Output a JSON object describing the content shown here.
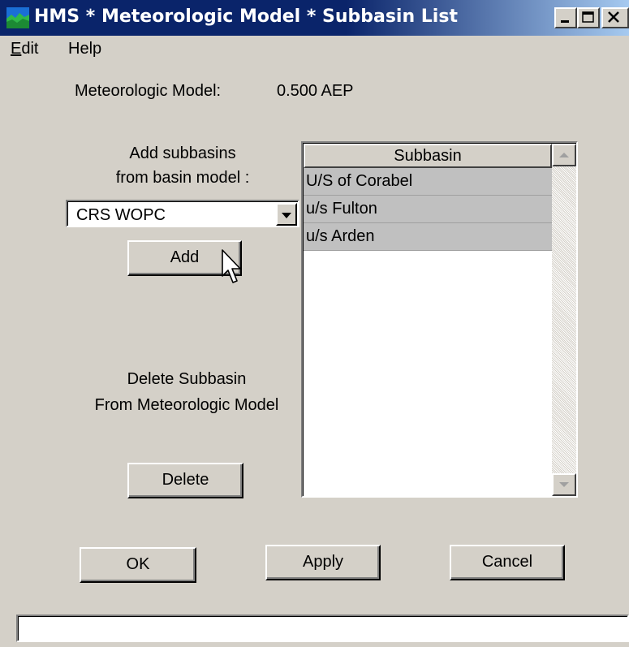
{
  "window": {
    "title": "HMS * Meteorologic Model * Subbasin List",
    "minimize_icon": "minimize-icon",
    "maximize_icon": "maximize-icon",
    "close_icon": "close-icon",
    "title_bar_color": "#0a246a"
  },
  "menu": {
    "items": [
      {
        "label_access": "E",
        "label_rest": "dit"
      },
      {
        "label": "Help"
      }
    ]
  },
  "model": {
    "label": "Meteorologic Model:",
    "value": "0.500 AEP"
  },
  "add_section": {
    "line1": "Add subbasins",
    "line2": "from basin model :",
    "basin_selected": "CRS WOPC",
    "add_button": "Add"
  },
  "delete_section": {
    "line1": "Delete Subbasin",
    "line2": "From Meteorologic Model",
    "delete_button": "Delete"
  },
  "subbasin_list": {
    "header": "Subbasin",
    "rows": [
      "U/S of Corabel",
      "u/s Fulton",
      "u/s Arden"
    ]
  },
  "footer": {
    "ok": "OK",
    "apply": "Apply",
    "cancel": "Cancel"
  },
  "status": {
    "text": ""
  }
}
